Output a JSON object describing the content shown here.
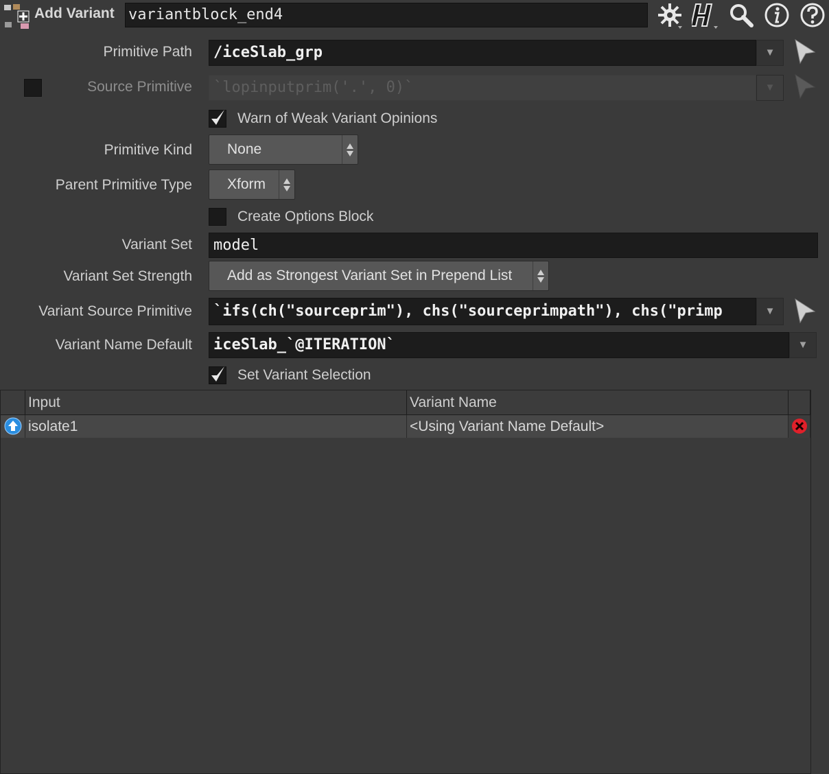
{
  "header": {
    "node_type": "Add Variant",
    "node_name": "variantblock_end4",
    "icons": [
      "gear-icon",
      "houdini-help-icon",
      "search-icon",
      "info-icon",
      "help-icon"
    ]
  },
  "parms": {
    "primitive_path": {
      "label": "Primitive Path",
      "value": "/iceSlab_grp"
    },
    "source_primitive": {
      "label": "Source Primitive",
      "value": "`lopinputprim('.', 0)`",
      "enabled": false
    },
    "warn_weak": {
      "label": "Warn of Weak Variant Opinions",
      "checked": true
    },
    "primitive_kind": {
      "label": "Primitive Kind",
      "value": "None"
    },
    "parent_prim_type": {
      "label": "Parent Primitive Type",
      "value": "Xform"
    },
    "create_options": {
      "label": "Create Options Block",
      "checked": false
    },
    "variant_set": {
      "label": "Variant Set",
      "value": "model"
    },
    "variant_set_strength": {
      "label": "Variant Set Strength",
      "value": "Add as Strongest Variant Set in Prepend List"
    },
    "variant_source_prim": {
      "label": "Variant Source Primitive",
      "value": "`ifs(ch(\"sourceprim\"), chs(\"sourceprimpath\"), chs(\"primp"
    },
    "variant_name_default": {
      "label": "Variant Name Default",
      "value": "iceSlab_`@ITERATION`"
    },
    "set_variant_selection": {
      "label": "Set Variant Selection",
      "checked": true
    }
  },
  "table": {
    "columns": [
      "Input",
      "Variant Name"
    ],
    "rows": [
      {
        "input": "isolate1",
        "variant_name": "<Using Variant Name Default>"
      }
    ]
  },
  "colors": {
    "background": "#3a3a3a",
    "field": "#1c1c1c",
    "delete": "#e0202a",
    "input_arrow": "#2a8ee0"
  }
}
